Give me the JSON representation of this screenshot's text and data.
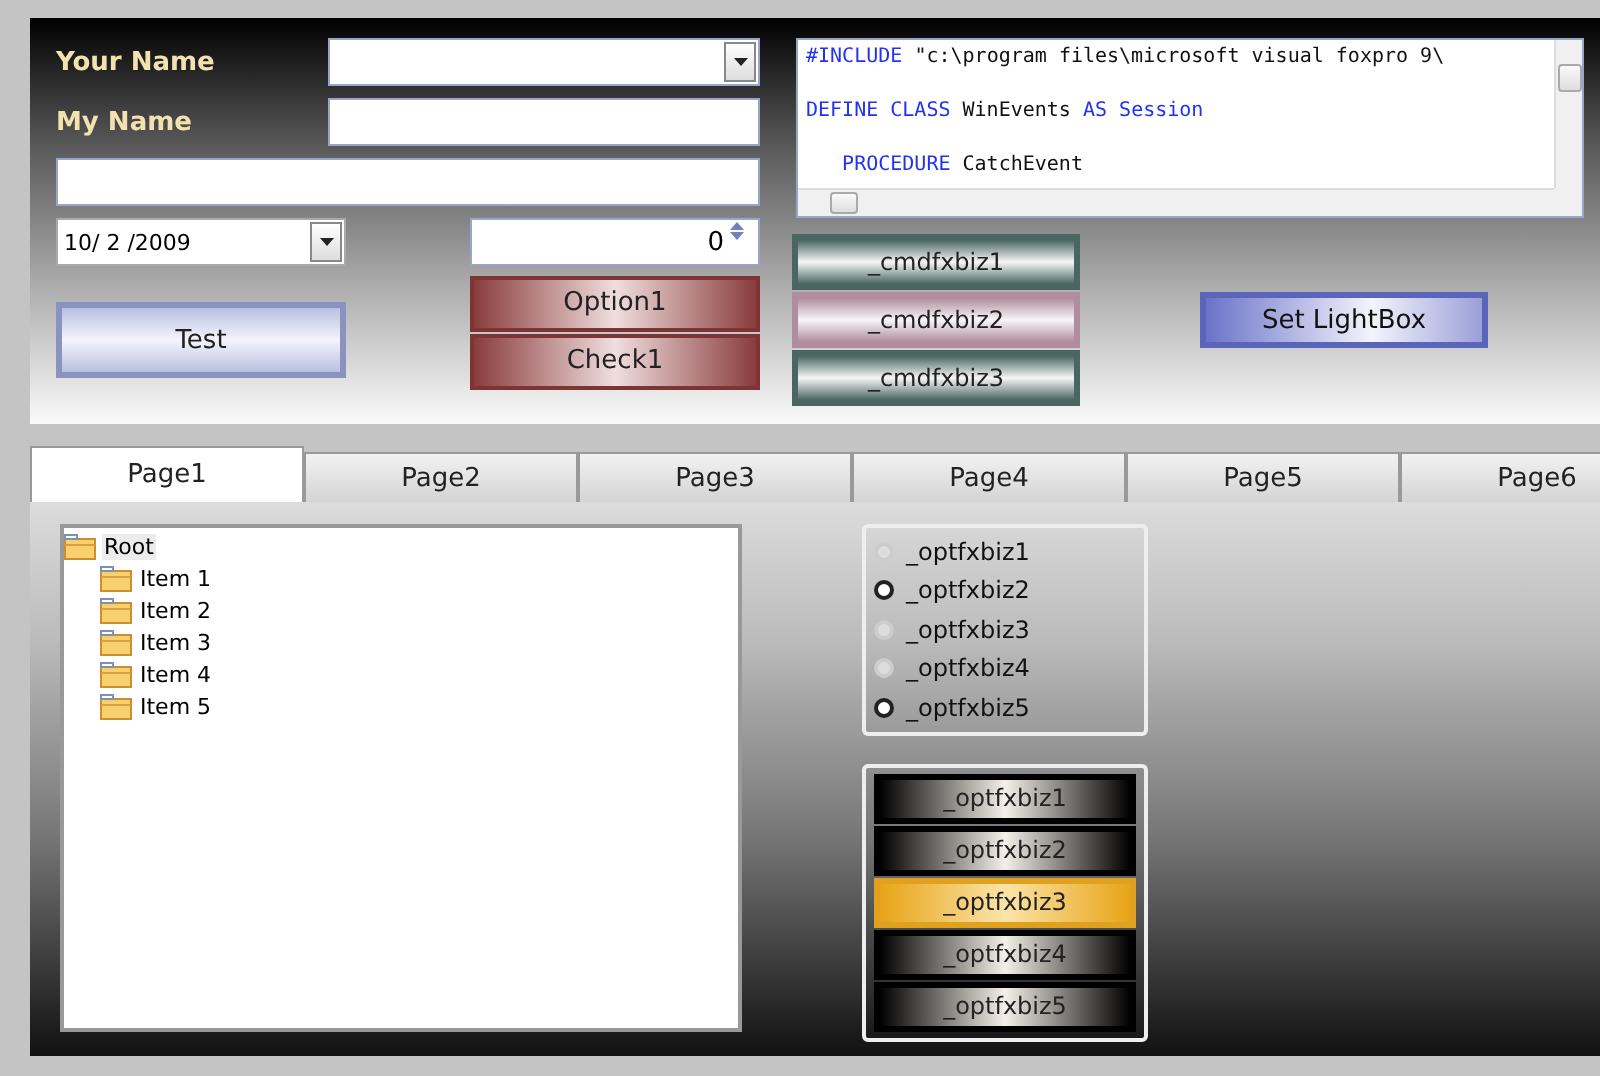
{
  "labels": [
    "Your Name",
    "My Name"
  ],
  "date_field": {
    "value": "10/ 2 /2009"
  },
  "spinner": {
    "value": "0"
  },
  "test_button": "Test",
  "state_buttons": [
    {
      "label": "Option1"
    },
    {
      "label": "Check1"
    }
  ],
  "code_editor": {
    "lines": [
      [
        {
          "text": "#INCLUDE",
          "kind": "keyword"
        },
        {
          "text": " \"c:\\program files\\microsoft visual foxpro 9\\",
          "kind": "plain"
        }
      ],
      [
        {
          "text": "DEFINE CLASS",
          "kind": "keyword"
        },
        {
          "text": " WinEvents ",
          "kind": "plain"
        },
        {
          "text": "AS Session",
          "kind": "keyword"
        }
      ],
      [
        {
          "text": "   PROCEDURE",
          "kind": "keyword"
        },
        {
          "text": " CatchEvent",
          "kind": "plain"
        }
      ]
    ]
  },
  "command_buttons": [
    {
      "label": "_cmdfxbiz1",
      "color": "#4a6660"
    },
    {
      "label": "_cmdfxbiz2",
      "color": "#b08c9c"
    },
    {
      "label": "_cmdfxbiz3",
      "color": "#4a6660"
    }
  ],
  "lightbox_button": "Set LightBox",
  "tabs": [
    {
      "label": "Page1",
      "selected": true
    },
    {
      "label": "Page2",
      "selected": false
    },
    {
      "label": "Page3",
      "selected": false
    },
    {
      "label": "Page4",
      "selected": false
    },
    {
      "label": "Page5",
      "selected": false
    },
    {
      "label": "Page6",
      "selected": false
    }
  ],
  "tree": [
    {
      "label": "Root",
      "selected": true,
      "children": [
        {
          "label": "Item 1",
          "selected": false
        },
        {
          "label": "Item 2",
          "selected": false
        },
        {
          "label": "Item 3",
          "selected": false
        },
        {
          "label": "Item 4",
          "selected": false
        },
        {
          "label": "Item 5",
          "selected": false
        }
      ]
    }
  ],
  "option_group": [
    {
      "label": "_optfxbiz1",
      "disabled": true
    },
    {
      "label": "_optfxbiz2",
      "disabled": false
    },
    {
      "label": "_optfxbiz3",
      "disabled": true
    },
    {
      "label": "_optfxbiz4",
      "disabled": true
    },
    {
      "label": "_optfxbiz5",
      "disabled": false
    }
  ],
  "graphic_option_group": [
    {
      "label": "_optfxbiz1",
      "selected": false
    },
    {
      "label": "_optfxbiz2",
      "selected": false
    },
    {
      "label": "_optfxbiz3",
      "selected": true
    },
    {
      "label": "_optfxbiz4",
      "selected": false
    },
    {
      "label": "_optfxbiz5",
      "selected": false
    }
  ]
}
